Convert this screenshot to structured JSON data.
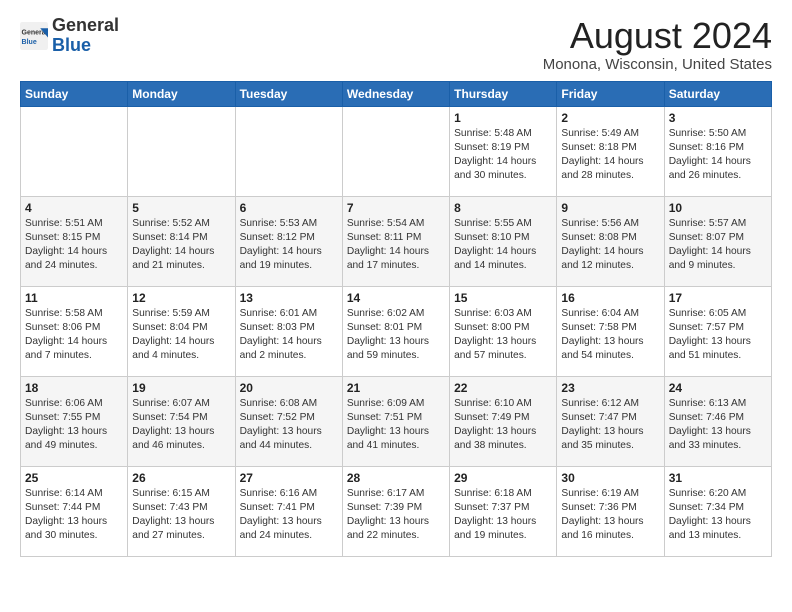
{
  "logo": {
    "general": "General",
    "blue": "Blue"
  },
  "title": "August 2024",
  "subtitle": "Monona, Wisconsin, United States",
  "days_of_week": [
    "Sunday",
    "Monday",
    "Tuesday",
    "Wednesday",
    "Thursday",
    "Friday",
    "Saturday"
  ],
  "weeks": [
    [
      {
        "day": "",
        "info": ""
      },
      {
        "day": "",
        "info": ""
      },
      {
        "day": "",
        "info": ""
      },
      {
        "day": "",
        "info": ""
      },
      {
        "day": "1",
        "info": "Sunrise: 5:48 AM\nSunset: 8:19 PM\nDaylight: 14 hours\nand 30 minutes."
      },
      {
        "day": "2",
        "info": "Sunrise: 5:49 AM\nSunset: 8:18 PM\nDaylight: 14 hours\nand 28 minutes."
      },
      {
        "day": "3",
        "info": "Sunrise: 5:50 AM\nSunset: 8:16 PM\nDaylight: 14 hours\nand 26 minutes."
      }
    ],
    [
      {
        "day": "4",
        "info": "Sunrise: 5:51 AM\nSunset: 8:15 PM\nDaylight: 14 hours\nand 24 minutes."
      },
      {
        "day": "5",
        "info": "Sunrise: 5:52 AM\nSunset: 8:14 PM\nDaylight: 14 hours\nand 21 minutes."
      },
      {
        "day": "6",
        "info": "Sunrise: 5:53 AM\nSunset: 8:12 PM\nDaylight: 14 hours\nand 19 minutes."
      },
      {
        "day": "7",
        "info": "Sunrise: 5:54 AM\nSunset: 8:11 PM\nDaylight: 14 hours\nand 17 minutes."
      },
      {
        "day": "8",
        "info": "Sunrise: 5:55 AM\nSunset: 8:10 PM\nDaylight: 14 hours\nand 14 minutes."
      },
      {
        "day": "9",
        "info": "Sunrise: 5:56 AM\nSunset: 8:08 PM\nDaylight: 14 hours\nand 12 minutes."
      },
      {
        "day": "10",
        "info": "Sunrise: 5:57 AM\nSunset: 8:07 PM\nDaylight: 14 hours\nand 9 minutes."
      }
    ],
    [
      {
        "day": "11",
        "info": "Sunrise: 5:58 AM\nSunset: 8:06 PM\nDaylight: 14 hours\nand 7 minutes."
      },
      {
        "day": "12",
        "info": "Sunrise: 5:59 AM\nSunset: 8:04 PM\nDaylight: 14 hours\nand 4 minutes."
      },
      {
        "day": "13",
        "info": "Sunrise: 6:01 AM\nSunset: 8:03 PM\nDaylight: 14 hours\nand 2 minutes."
      },
      {
        "day": "14",
        "info": "Sunrise: 6:02 AM\nSunset: 8:01 PM\nDaylight: 13 hours\nand 59 minutes."
      },
      {
        "day": "15",
        "info": "Sunrise: 6:03 AM\nSunset: 8:00 PM\nDaylight: 13 hours\nand 57 minutes."
      },
      {
        "day": "16",
        "info": "Sunrise: 6:04 AM\nSunset: 7:58 PM\nDaylight: 13 hours\nand 54 minutes."
      },
      {
        "day": "17",
        "info": "Sunrise: 6:05 AM\nSunset: 7:57 PM\nDaylight: 13 hours\nand 51 minutes."
      }
    ],
    [
      {
        "day": "18",
        "info": "Sunrise: 6:06 AM\nSunset: 7:55 PM\nDaylight: 13 hours\nand 49 minutes."
      },
      {
        "day": "19",
        "info": "Sunrise: 6:07 AM\nSunset: 7:54 PM\nDaylight: 13 hours\nand 46 minutes."
      },
      {
        "day": "20",
        "info": "Sunrise: 6:08 AM\nSunset: 7:52 PM\nDaylight: 13 hours\nand 44 minutes."
      },
      {
        "day": "21",
        "info": "Sunrise: 6:09 AM\nSunset: 7:51 PM\nDaylight: 13 hours\nand 41 minutes."
      },
      {
        "day": "22",
        "info": "Sunrise: 6:10 AM\nSunset: 7:49 PM\nDaylight: 13 hours\nand 38 minutes."
      },
      {
        "day": "23",
        "info": "Sunrise: 6:12 AM\nSunset: 7:47 PM\nDaylight: 13 hours\nand 35 minutes."
      },
      {
        "day": "24",
        "info": "Sunrise: 6:13 AM\nSunset: 7:46 PM\nDaylight: 13 hours\nand 33 minutes."
      }
    ],
    [
      {
        "day": "25",
        "info": "Sunrise: 6:14 AM\nSunset: 7:44 PM\nDaylight: 13 hours\nand 30 minutes."
      },
      {
        "day": "26",
        "info": "Sunrise: 6:15 AM\nSunset: 7:43 PM\nDaylight: 13 hours\nand 27 minutes."
      },
      {
        "day": "27",
        "info": "Sunrise: 6:16 AM\nSunset: 7:41 PM\nDaylight: 13 hours\nand 24 minutes."
      },
      {
        "day": "28",
        "info": "Sunrise: 6:17 AM\nSunset: 7:39 PM\nDaylight: 13 hours\nand 22 minutes."
      },
      {
        "day": "29",
        "info": "Sunrise: 6:18 AM\nSunset: 7:37 PM\nDaylight: 13 hours\nand 19 minutes."
      },
      {
        "day": "30",
        "info": "Sunrise: 6:19 AM\nSunset: 7:36 PM\nDaylight: 13 hours\nand 16 minutes."
      },
      {
        "day": "31",
        "info": "Sunrise: 6:20 AM\nSunset: 7:34 PM\nDaylight: 13 hours\nand 13 minutes."
      }
    ]
  ]
}
